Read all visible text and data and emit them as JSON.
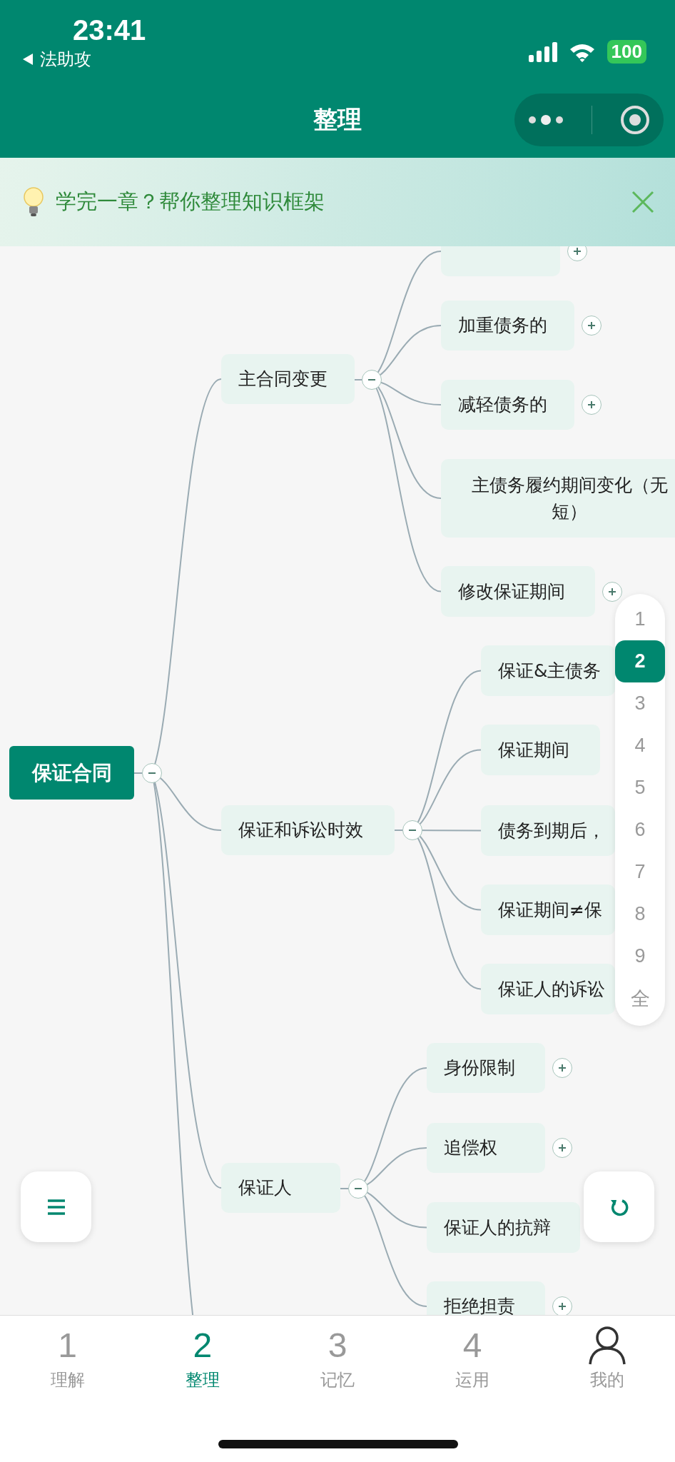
{
  "status_bar": {
    "time": "23:41",
    "back_label": "法助攻",
    "battery": "100"
  },
  "nav_bar": {
    "title": "整理"
  },
  "banner": {
    "text": "学完一章？帮你整理知识框架"
  },
  "mind_map": {
    "root": {
      "text": "保证合同",
      "expanded": true,
      "children": [
        {
          "text": "主合同变更",
          "expanded": true,
          "children": [
            {
              "expanded": false
            },
            {
              "text": "加重债务的",
              "expanded": false
            },
            {
              "text": "减轻债务的",
              "expanded": false
            },
            {
              "lines": [
                "主债务履约期间变化（无",
                "短）"
              ]
            },
            {
              "text": "修改保证期间",
              "expanded": false
            }
          ]
        },
        {
          "text": "保证和诉讼时效",
          "expanded": true,
          "children": [
            {
              "text": "保证&主债务"
            },
            {
              "text": "保证期间"
            },
            {
              "text": "债务到期后，"
            },
            {
              "text": "保证期间≠保"
            },
            {
              "text": "保证人的诉讼"
            }
          ]
        },
        {
          "text": "保证人",
          "expanded": true,
          "children": [
            {
              "text": "身份限制",
              "expanded": false
            },
            {
              "text": "追偿权",
              "expanded": false
            },
            {
              "text": "保证人的抗辩"
            },
            {
              "text": "拒绝担责",
              "expanded": false
            }
          ]
        }
      ]
    }
  },
  "level_picker": [
    {
      "label": "1",
      "selected": false
    },
    {
      "label": "2",
      "selected": true
    },
    {
      "label": "3",
      "selected": false
    },
    {
      "label": "4",
      "selected": false
    },
    {
      "label": "5",
      "selected": false
    },
    {
      "label": "6",
      "selected": false
    },
    {
      "label": "7",
      "selected": false
    },
    {
      "label": "8",
      "selected": false
    },
    {
      "label": "9",
      "selected": false
    },
    {
      "label": "全",
      "selected": false
    }
  ],
  "tab_bar": [
    {
      "kind": "number",
      "number": "1",
      "label": "理解",
      "selected": false
    },
    {
      "kind": "number",
      "number": "2",
      "label": "整理",
      "selected": true
    },
    {
      "kind": "number",
      "number": "3",
      "label": "记忆",
      "selected": false
    },
    {
      "kind": "number",
      "number": "4",
      "label": "运用",
      "selected": false
    },
    {
      "kind": "profile",
      "label": "我的",
      "selected": false
    }
  ]
}
